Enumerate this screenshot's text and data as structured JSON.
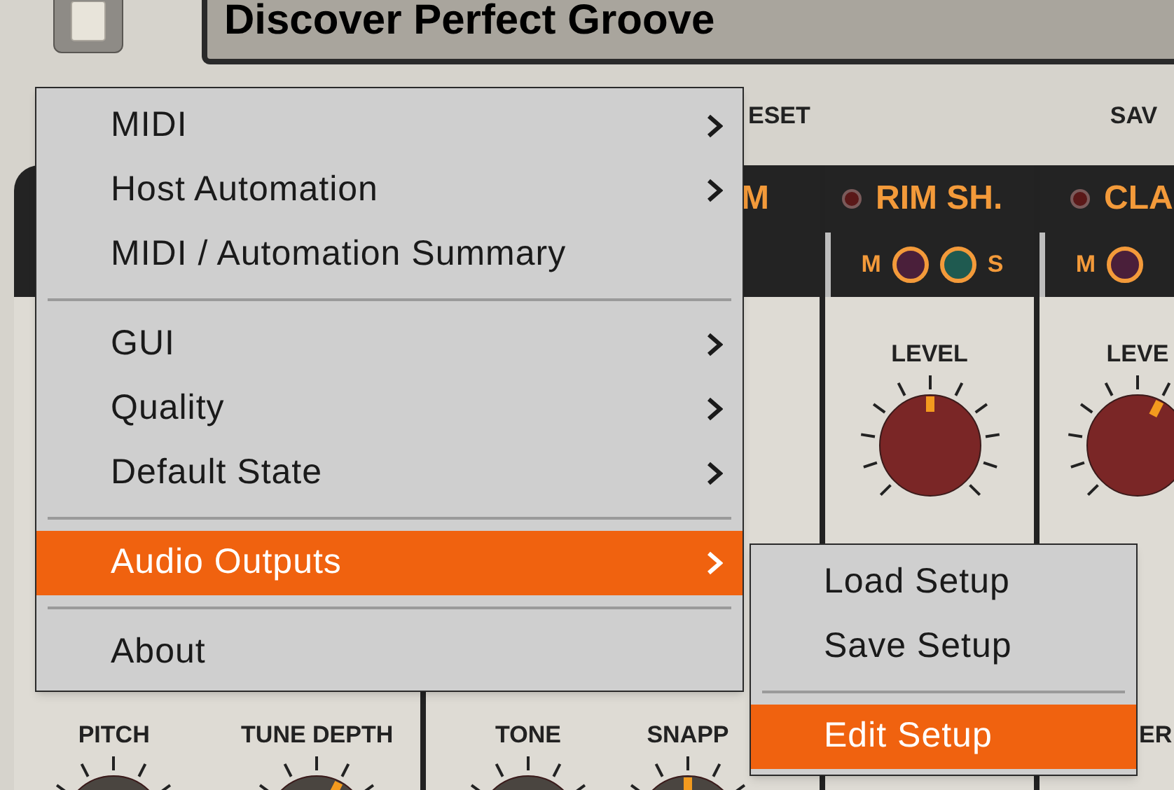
{
  "header": {
    "title": "Discover Perfect Groove",
    "actions": [
      "ESET",
      "SAV"
    ]
  },
  "channels": [
    {
      "bottom_knobs": [
        {
          "kind": "knob",
          "label": "PITCH",
          "color": "#4a4540"
        },
        {
          "kind": "knob",
          "label": "TUNE DEPTH",
          "color": "#4a4540",
          "level": 0.6
        }
      ]
    },
    {
      "name": "M",
      "bottom_knobs": [
        {
          "kind": "knob",
          "label": "TONE",
          "color": "#4a4540"
        },
        {
          "kind": "knob",
          "label": "SNAPP",
          "color": "#4a4540",
          "level": 0.5
        }
      ]
    },
    {
      "name": "RIM SH.",
      "ms": [
        "M",
        "S"
      ],
      "top_knobs": [
        {
          "kind": "knob",
          "label": "LEVEL",
          "color": "#7a2626",
          "level": 0.5
        }
      ]
    },
    {
      "name": "CLA",
      "ms": [
        "M"
      ],
      "top_knobs": [
        {
          "kind": "knob",
          "label": "LEVE",
          "color": "#7a2626",
          "level": 0.6
        }
      ],
      "bottom_knobs": [
        {
          "kind": "label",
          "label": "ER"
        }
      ]
    }
  ],
  "menu": {
    "items": [
      {
        "kind": "item",
        "label": "MIDI",
        "submenu": true,
        "selected": false
      },
      {
        "kind": "item",
        "label": "Host Automation",
        "submenu": true,
        "selected": false
      },
      {
        "kind": "item",
        "label": "MIDI / Automation Summary",
        "submenu": false,
        "selected": false
      },
      {
        "kind": "separator"
      },
      {
        "kind": "item",
        "label": "GUI",
        "submenu": true,
        "selected": false
      },
      {
        "kind": "item",
        "label": "Quality",
        "submenu": true,
        "selected": false
      },
      {
        "kind": "item",
        "label": "Default State",
        "submenu": true,
        "selected": false
      },
      {
        "kind": "separator"
      },
      {
        "kind": "item",
        "label": "Audio Outputs",
        "submenu": true,
        "selected": true
      },
      {
        "kind": "separator"
      },
      {
        "kind": "item",
        "label": "About",
        "submenu": false,
        "selected": false
      }
    ]
  },
  "submenu": {
    "items": [
      {
        "kind": "item",
        "label": "Load Setup",
        "submenu": false,
        "selected": false
      },
      {
        "kind": "item",
        "label": "Save Setup",
        "submenu": false,
        "selected": false
      },
      {
        "kind": "separator"
      },
      {
        "kind": "item",
        "label": "Edit Setup",
        "submenu": false,
        "selected": true
      }
    ]
  }
}
